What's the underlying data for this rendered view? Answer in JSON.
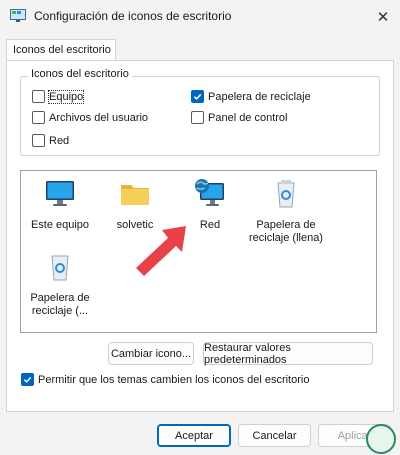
{
  "window": {
    "title": "Configuración de iconos de escritorio",
    "close_glyph": "✕"
  },
  "tab": {
    "label": "Iconos del escritorio"
  },
  "group": {
    "legend": "Iconos del escritorio",
    "checkboxes": [
      {
        "label": "Equipo",
        "checked": false
      },
      {
        "label": "Archivos del usuario",
        "checked": false
      },
      {
        "label": "Red",
        "checked": false
      },
      {
        "label": "Papelera de reciclaje",
        "checked": true
      },
      {
        "label": "Panel de control",
        "checked": false
      }
    ]
  },
  "icons": [
    {
      "label": "Este equipo",
      "icon": "monitor-icon"
    },
    {
      "label": "solvetic",
      "icon": "folder-icon"
    },
    {
      "label": "Red",
      "icon": "network-globe-icon"
    },
    {
      "label": "Papelera de reciclaje (llena)",
      "icon": "recycle-bin-full-icon"
    },
    {
      "label": "Papelera de reciclaje (...",
      "icon": "recycle-bin-empty-icon"
    }
  ],
  "buttons": {
    "change_icon": "Cambiar icono...",
    "restore_defaults": "Restaurar valores predeterminados",
    "accept": "Aceptar",
    "cancel": "Cancelar",
    "apply": "Aplicar"
  },
  "theme_checkbox": {
    "label": "Permitir que los temas cambien los iconos del escritorio",
    "checked": true
  },
  "colors": {
    "accent": "#0067c0",
    "arrow": "#e8414a"
  }
}
